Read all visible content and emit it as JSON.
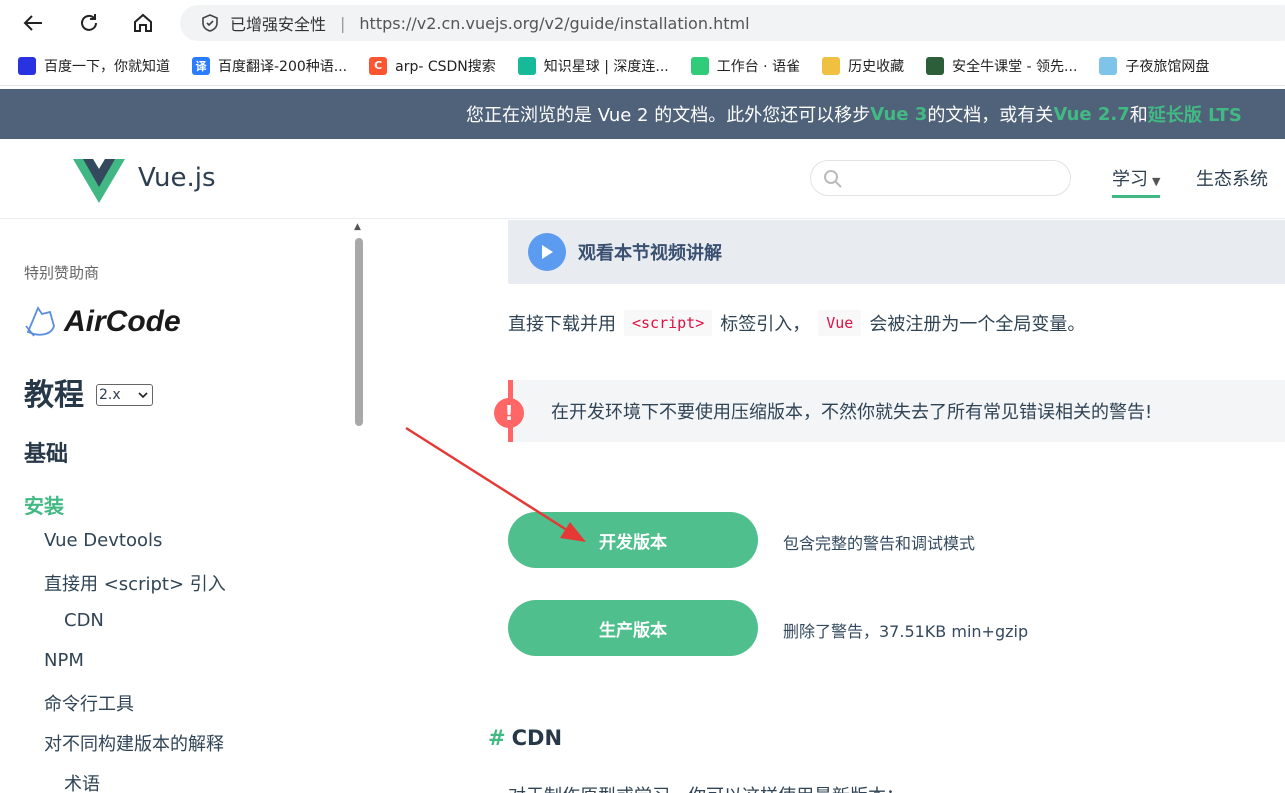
{
  "browser": {
    "security_label": "已增强安全性",
    "url": "https://v2.cn.vuejs.org/v2/guide/installation.html",
    "bookmarks": [
      {
        "label": "百度一下，你就知道",
        "icon": "baidu-paw-icon",
        "color": "#2932e1"
      },
      {
        "label": "百度翻译-200种语...",
        "icon": "translate-icon",
        "color": "#2b7cff",
        "glyph": "译"
      },
      {
        "label": "arp- CSDN搜索",
        "icon": "csdn-icon",
        "color": "#fc5531",
        "glyph": "C"
      },
      {
        "label": "知识星球 | 深度连...",
        "icon": "zsxq-icon",
        "color": "#16b998"
      },
      {
        "label": "工作台 · 语雀",
        "icon": "yuque-icon",
        "color": "#31cc79"
      },
      {
        "label": "历史收藏",
        "icon": "folder-icon",
        "color": "#f0c040"
      },
      {
        "label": "安全牛课堂 - 领先...",
        "icon": "aqniu-icon",
        "color": "#2d5e3a"
      },
      {
        "label": "子夜旅馆网盘",
        "icon": "cloud-disk-icon",
        "color": "#7ec3e8"
      }
    ]
  },
  "banner": {
    "p1": "您正在浏览的是 Vue 2 的文档。此外您还可以移步 ",
    "vue3": "Vue 3",
    "p2": " 的文档，或有关 ",
    "vue27": "Vue 2.7",
    "p3": " 和 ",
    "lts": "延长版 LTS"
  },
  "header": {
    "brand": "Vue.js",
    "search_placeholder": "",
    "nav_learn": "学习",
    "nav_eco": "生态系统"
  },
  "sidebar": {
    "sponsor_label": "特别赞助商",
    "sponsor_name": "AirCode",
    "tutorial_title": "教程",
    "version": "2.x",
    "section_title": "基础",
    "items": [
      {
        "label": "安装",
        "level": 0,
        "active": true
      },
      {
        "label": "Vue Devtools",
        "level": 1
      },
      {
        "label": "直接用 <script> 引入",
        "level": 1
      },
      {
        "label": "CDN",
        "level": 2
      },
      {
        "label": "NPM",
        "level": 1
      },
      {
        "label": "命令行工具",
        "level": 1
      },
      {
        "label": "对不同构建版本的解释",
        "level": 1
      },
      {
        "label": "术语",
        "level": 2
      }
    ]
  },
  "content": {
    "video_label": "观看本节视频讲解",
    "intro_before": "直接下载并用",
    "intro_code1": "<script>",
    "intro_mid": "标签引入，",
    "intro_code2": "Vue",
    "intro_after": "会被注册为一个全局变量。",
    "warning": "在开发环境下不要使用压缩版本，不然你就失去了所有常见错误相关的警告!",
    "dev_button": "开发版本",
    "dev_desc": "包含完整的警告和调试模式",
    "prod_button": "生产版本",
    "prod_desc": "删除了警告，37.51KB min+gzip",
    "cdn_heading": "CDN",
    "cut_text": "对于制作原型或学习，你可以这样使用最新版本："
  },
  "colors": {
    "accent": "#42b983",
    "button": "#4fc08d",
    "banner_bg": "#4f6279",
    "warn": "#ff6666",
    "annotation_arrow": "#e53935"
  }
}
